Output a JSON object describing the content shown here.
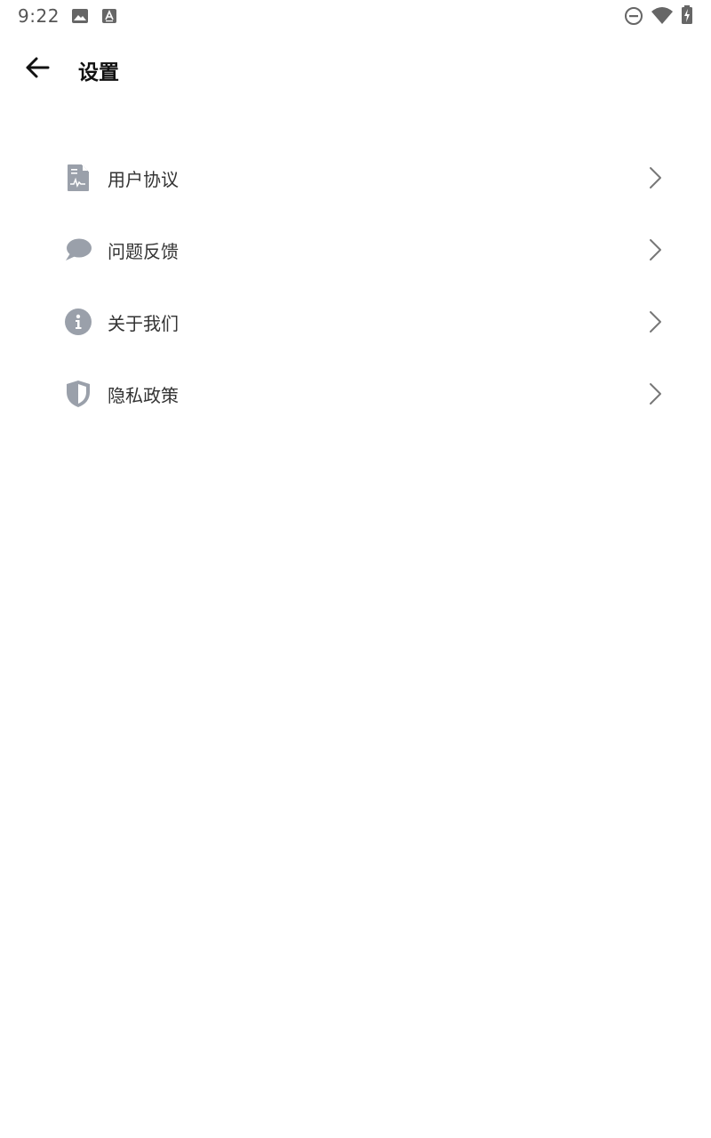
{
  "status_bar": {
    "time": "9:22",
    "left_icons": [
      "image-icon",
      "font-icon"
    ],
    "right_icons": [
      "do-not-disturb-icon",
      "wifi-icon",
      "battery-charging-icon"
    ]
  },
  "app_bar": {
    "title": "设置",
    "back_icon": "arrow-left-icon"
  },
  "menu": {
    "items": [
      {
        "label": "用户协议",
        "icon": "document-icon"
      },
      {
        "label": "问题反馈",
        "icon": "chat-bubble-icon"
      },
      {
        "label": "关于我们",
        "icon": "info-icon"
      },
      {
        "label": "隐私政策",
        "icon": "shield-icon"
      }
    ],
    "chevron_icon": "chevron-right-icon"
  },
  "colors": {
    "icon_gray": "#9aa0aa",
    "text": "#333333",
    "chevron": "#777777",
    "background": "#ffffff"
  }
}
